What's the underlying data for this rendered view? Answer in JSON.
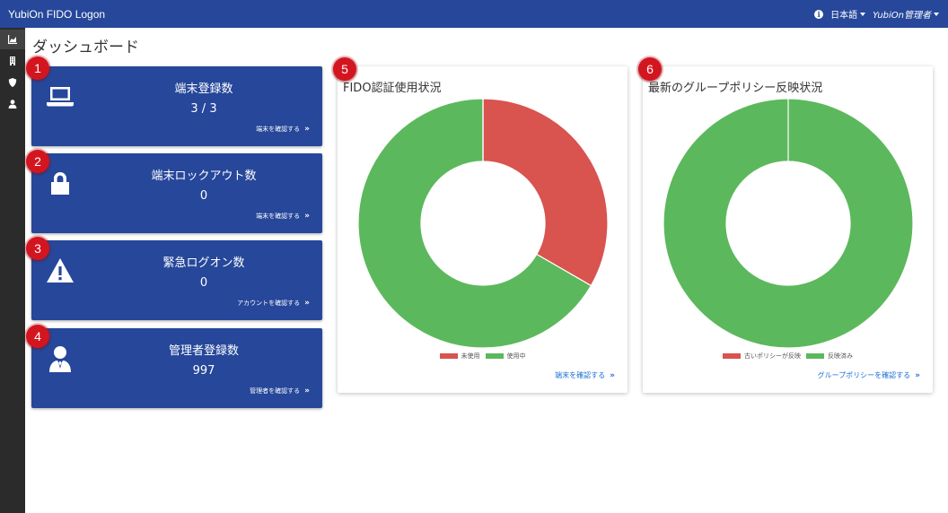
{
  "topbar": {
    "brand": "YubiOn FIDO Logon",
    "language": "日本語",
    "user": "YubiOn管理者",
    "info_icon": "info-circle-icon"
  },
  "sidenav": {
    "items": [
      {
        "name": "dashboard-chart-icon"
      },
      {
        "name": "building-icon"
      },
      {
        "name": "shield-icon"
      },
      {
        "name": "user-icon"
      }
    ]
  },
  "page": {
    "title": "ダッシュボード"
  },
  "colors": {
    "brand": "#26479a",
    "red": "#d9534f",
    "green": "#5cb85c",
    "badge": "#d3151f"
  },
  "cards": [
    {
      "badge": "1",
      "icon": "laptop-icon",
      "title": "端末登録数",
      "value": "3 / 3",
      "link": "端末を確認する",
      "link_arrow": "»"
    },
    {
      "badge": "2",
      "icon": "lock-icon",
      "title": "端末ロックアウト数",
      "value": "0",
      "link": "端末を確認する",
      "link_arrow": "»"
    },
    {
      "badge": "3",
      "icon": "warning-icon",
      "title": "緊急ログオン数",
      "value": "0",
      "link": "アカウントを確認する",
      "link_arrow": "»"
    },
    {
      "badge": "4",
      "icon": "admin-user-icon",
      "title": "管理者登録数",
      "value": "997",
      "link": "管理者を確認する",
      "link_arrow": "»"
    }
  ],
  "panels": [
    {
      "badge": "5",
      "title": "FIDO認証使用状況",
      "link": "端末を確認する",
      "link_arrow": "»"
    },
    {
      "badge": "6",
      "title": "最新のグループポリシー反映状況",
      "link": "グループポリシーを確認する",
      "link_arrow": "»"
    }
  ],
  "chart_data": [
    {
      "type": "pie",
      "variant": "doughnut",
      "title": "FIDO認証使用状況",
      "categories": [
        "未使用",
        "使用中"
      ],
      "values": [
        1,
        2
      ],
      "colors": [
        "#d9534f",
        "#5cb85c"
      ],
      "legend": "bottom"
    },
    {
      "type": "pie",
      "variant": "doughnut",
      "title": "最新のグループポリシー反映状況",
      "categories": [
        "古いポリシーが反映",
        "反映済み"
      ],
      "values": [
        0,
        1
      ],
      "colors": [
        "#d9534f",
        "#5cb85c"
      ],
      "legend": "bottom"
    }
  ]
}
